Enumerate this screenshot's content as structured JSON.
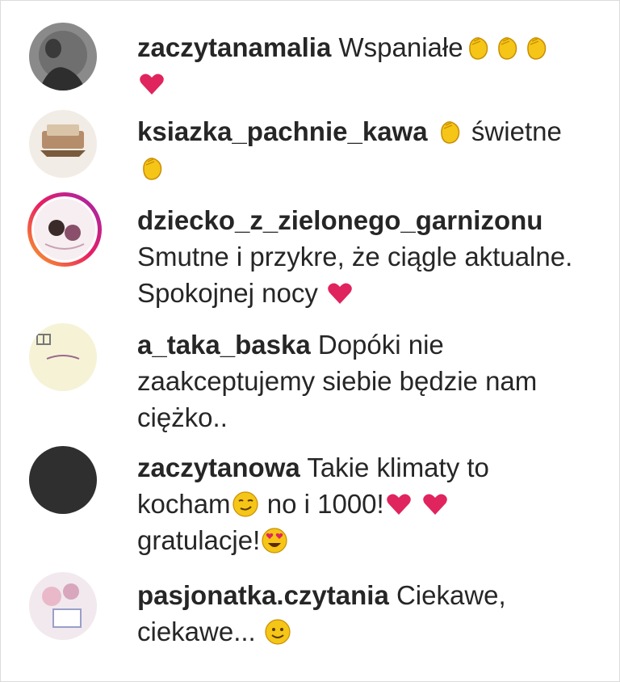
{
  "comments": [
    {
      "username": "zaczytanamalia",
      "text": "Wspaniałe",
      "emojis_after": [
        "clap",
        "clap",
        "clap",
        "heart"
      ]
    },
    {
      "username": "ksiazka_pachnie_kawa",
      "text_before": "",
      "text": "świetne",
      "emojis_mid": [
        "clap"
      ],
      "emojis_after": [
        "clap"
      ]
    },
    {
      "username": "dziecko_z_zielonego_garnizonu",
      "text": "Smutne i przykre, że ciągle aktualne. Spokojnej nocy",
      "emojis_after": [
        "heart"
      ]
    },
    {
      "username": "a_taka_baska",
      "text": "Dopóki nie zaakceptujemy siebie będzie nam ciężko.."
    },
    {
      "username": "zaczytanowa",
      "text": "Takie klimaty to kocham",
      "text2": "no i 1000!",
      "text3": "gratulacje!",
      "emojis": [
        "smirk",
        "heart",
        "heart",
        "heart-eyes"
      ]
    },
    {
      "username": "pasjonatka.czytania",
      "text": "Ciekawe, ciekawe...",
      "emojis_after": [
        "smile"
      ]
    }
  ],
  "icons": {
    "clap": "clapping-hands-icon",
    "heart": "red-heart-icon",
    "smirk": "smirking-face-icon",
    "heart_eyes": "heart-eyes-face-icon",
    "smile": "slightly-smiling-face-icon"
  },
  "colors": {
    "text": "#262626",
    "heart": "#e0245e",
    "emoji": "#f5c518"
  }
}
